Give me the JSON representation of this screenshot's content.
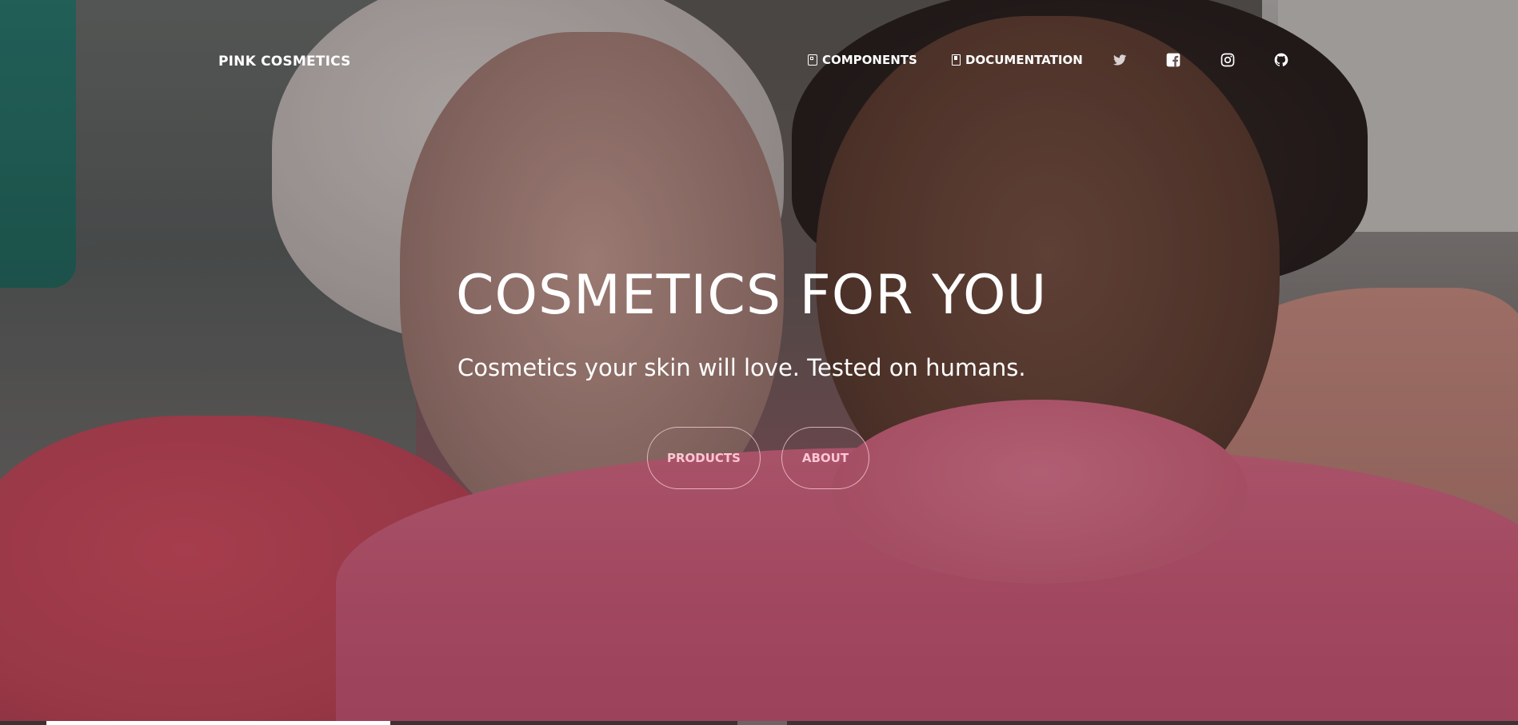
{
  "brand": {
    "label": "PINK COSMETICS"
  },
  "nav": {
    "components_label": "COMPONENTS",
    "documentation_label": "DOCUMENTATION"
  },
  "social": {
    "icons": [
      "twitter-icon",
      "facebook-icon",
      "instagram-icon",
      "github-icon"
    ]
  },
  "hero": {
    "title": "COSMETICS FOR YOU",
    "subtitle": "Cosmetics your skin will love. Tested on humans.",
    "products_button": "PRODUCTS",
    "about_button": "ABOUT"
  },
  "carousel": {
    "slide_count": 2,
    "active_index": 0
  },
  "colors": {
    "text": "#ffffff",
    "button_text": "#ffc6d4",
    "accent_pink": "#d86a86"
  }
}
